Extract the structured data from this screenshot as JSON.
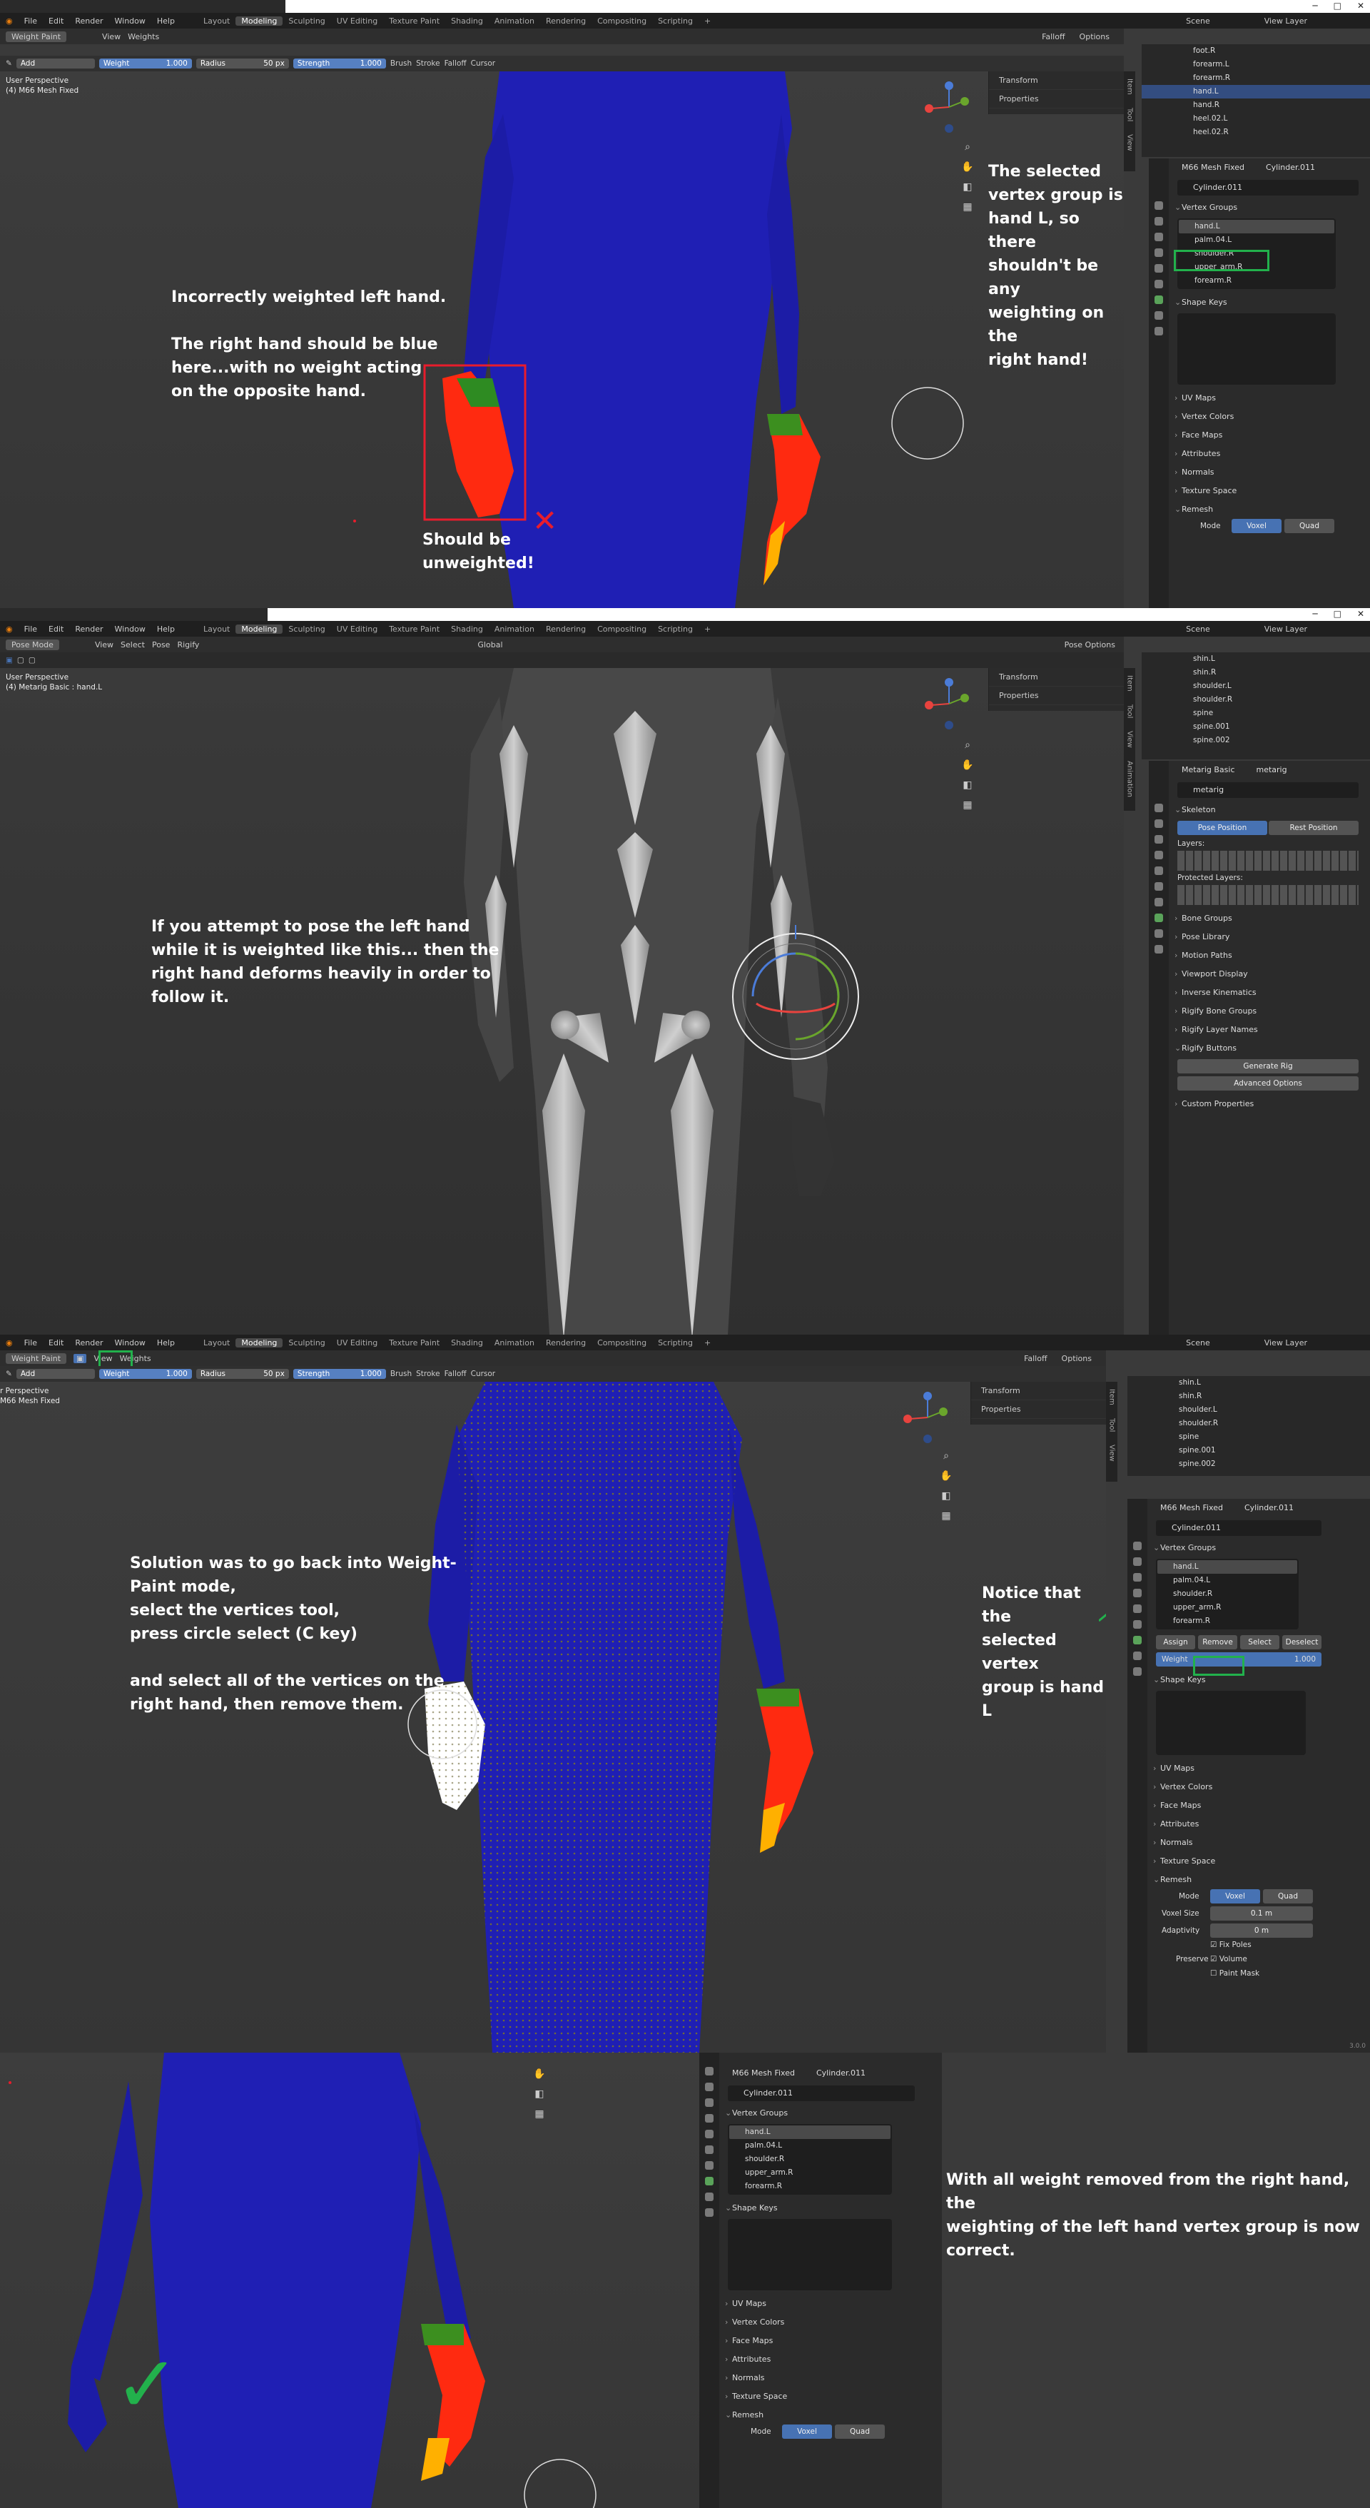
{
  "window": {
    "minimize": "─",
    "maximize": "□",
    "close": "✕"
  },
  "menu": [
    "File",
    "Edit",
    "Render",
    "Window",
    "Help"
  ],
  "workspaces": [
    "Layout",
    "Modeling",
    "Sculpting",
    "UV Editing",
    "Texture Paint",
    "Shading",
    "Animation",
    "Rendering",
    "Compositing",
    "Scripting",
    "+"
  ],
  "scene": "Scene",
  "view_layer": "View Layer",
  "panel1": {
    "mode": "Weight Paint",
    "menus": [
      "View",
      "Weights"
    ],
    "tool": {
      "blend": "Add",
      "weight_label": "Weight",
      "weight": "1.000",
      "radius_label": "Radius",
      "radius": "50 px",
      "strength_label": "Strength",
      "strength": "1.000",
      "brush": "Brush",
      "stroke": "Stroke",
      "falloff": "Falloff",
      "cursor": "Cursor",
      "falloff2": "Falloff",
      "options": "Options"
    },
    "vp_line1": "User Perspective",
    "vp_line2": "(4) M66 Mesh Fixed",
    "npanel": [
      "Transform",
      "Properties"
    ],
    "outliner": [
      "foot.R",
      "forearm.L",
      "forearm.R",
      "hand.L",
      "hand.R",
      "heel.02.L",
      "heel.02.R"
    ],
    "outliner_selected": 3,
    "props_path": [
      "M66 Mesh Fixed",
      "Cylinder.011"
    ],
    "object": "Cylinder.011",
    "vertex_groups_title": "Vertex Groups",
    "vgroups": [
      "hand.L",
      "palm.04.L",
      "shoulder.R",
      "upper_arm.R",
      "forearm.R"
    ],
    "shape_keys": "Shape Keys",
    "sections": [
      "UV Maps",
      "Vertex Colors",
      "Face Maps",
      "Attributes",
      "Normals",
      "Texture Space"
    ],
    "remesh": "Remesh",
    "mode_label": "Mode",
    "voxel": "Voxel",
    "quad": "Quad",
    "note_left": "Incorrectly weighted left hand.\n\nThe right hand should be blue\nhere...with no weight acting\non the opposite hand.",
    "note_bottom": "Should be\nunweighted!",
    "note_right": "The selected\nvertex group is\nhand L, so there\nshouldn't be any\nweighting on the\nright hand!",
    "x_mark": "✕"
  },
  "panel2": {
    "mode": "Pose Mode",
    "menus": [
      "View",
      "Select",
      "Pose",
      "Rigify"
    ],
    "transform": "Global",
    "pose_options": "Pose Options",
    "vp_line1": "User Perspective",
    "vp_line2": "(4) Metarig Basic : hand.L",
    "npanel": [
      "Transform",
      "Properties"
    ],
    "outliner": [
      "shin.L",
      "shin.R",
      "shoulder.L",
      "shoulder.R",
      "spine",
      "spine.001",
      "spine.002"
    ],
    "props_path": [
      "Metarig Basic",
      "metarig"
    ],
    "object": "metarig",
    "skeleton": "Skeleton",
    "pose_position": "Pose Position",
    "rest_position": "Rest Position",
    "layers": "Layers:",
    "protected_layers": "Protected Layers:",
    "sections": [
      "Bone Groups",
      "Pose Library",
      "Motion Paths",
      "Viewport Display",
      "Inverse Kinematics",
      "Rigify Bone Groups",
      "Rigify Layer Names"
    ],
    "rigify_buttons": "Rigify Buttons",
    "generate_rig": "Generate Rig",
    "advanced_options": "Advanced Options",
    "custom_properties": "Custom Properties",
    "note": "If you attempt to pose the left hand\nwhile it is weighted like this... then the\nright hand deforms heavily in order to\nfollow it."
  },
  "panel3": {
    "mode": "Weight Paint",
    "menus": [
      "View",
      "Weights"
    ],
    "tool": {
      "blend": "Add",
      "weight_label": "Weight",
      "weight": "1.000",
      "radius_label": "Radius",
      "radius": "50 px",
      "strength_label": "Strength",
      "strength": "1.000",
      "brush": "Brush",
      "stroke": "Stroke",
      "falloff": "Falloff",
      "cursor": "Cursor",
      "falloff2": "Falloff",
      "options": "Options"
    },
    "vp_line1": "r Perspective",
    "vp_line2": "M66 Mesh Fixed",
    "npanel": [
      "Transform",
      "Properties"
    ],
    "outliner": [
      "shin.L",
      "shin.R",
      "shoulder.L",
      "shoulder.R",
      "spine",
      "spine.001",
      "spine.002"
    ],
    "props_path": [
      "M66 Mesh Fixed",
      "Cylinder.011"
    ],
    "object": "Cylinder.011",
    "vertex_groups_title": "Vertex Groups",
    "vgroups": [
      "hand.L",
      "palm.04.L",
      "shoulder.R",
      "upper_arm.R",
      "forearm.R"
    ],
    "assign": "Assign",
    "remove": "Remove",
    "select": "Select",
    "deselect": "Deselect",
    "weight_label": "Weight",
    "weight": "1.000",
    "shape_keys": "Shape Keys",
    "sections": [
      "UV Maps",
      "Vertex Colors",
      "Face Maps",
      "Attributes",
      "Normals",
      "Texture Space"
    ],
    "remesh": "Remesh",
    "mode_label": "Mode",
    "voxel": "Voxel",
    "quad": "Quad",
    "voxel_size_label": "Voxel Size",
    "voxel_size": "0.1 m",
    "adaptivity_label": "Adaptivity",
    "adaptivity": "0 m",
    "fix_poles": "Fix Poles",
    "preserve": "Preserve",
    "volume": "Volume",
    "paint_mask": "Paint Mask",
    "version": "3.0.0",
    "note_left": "Solution was to go back into Weight-\nPaint mode,\nselect the vertices tool,\npress circle select (C key)\n\nand select all of the vertices on the\nright hand, then remove them.",
    "note_right": "Notice that the\nselected vertex\ngroup is hand L"
  },
  "panel4": {
    "props_path": [
      "M66 Mesh Fixed",
      "Cylinder.011"
    ],
    "object": "Cylinder.011",
    "vertex_groups_title": "Vertex Groups",
    "vgroups": [
      "hand.L",
      "palm.04.L",
      "shoulder.R",
      "upper_arm.R",
      "forearm.R"
    ],
    "shape_keys": "Shape Keys",
    "sections": [
      "UV Maps",
      "Vertex Colors",
      "Face Maps",
      "Attributes",
      "Normals",
      "Texture Space"
    ],
    "remesh": "Remesh",
    "mode_label": "Mode",
    "voxel": "Voxel",
    "quad": "Quad",
    "note": "With all weight removed from the right hand, the\nweighting of the left hand vertex group is now\ncorrect.",
    "check": "✓"
  },
  "colors": {
    "body_blue": "#1f1fb4",
    "weight_red": "#ff2a10",
    "highlight_green": "#22b14c",
    "box_red": "#e81c2c",
    "select_blue": "#4772b3"
  }
}
